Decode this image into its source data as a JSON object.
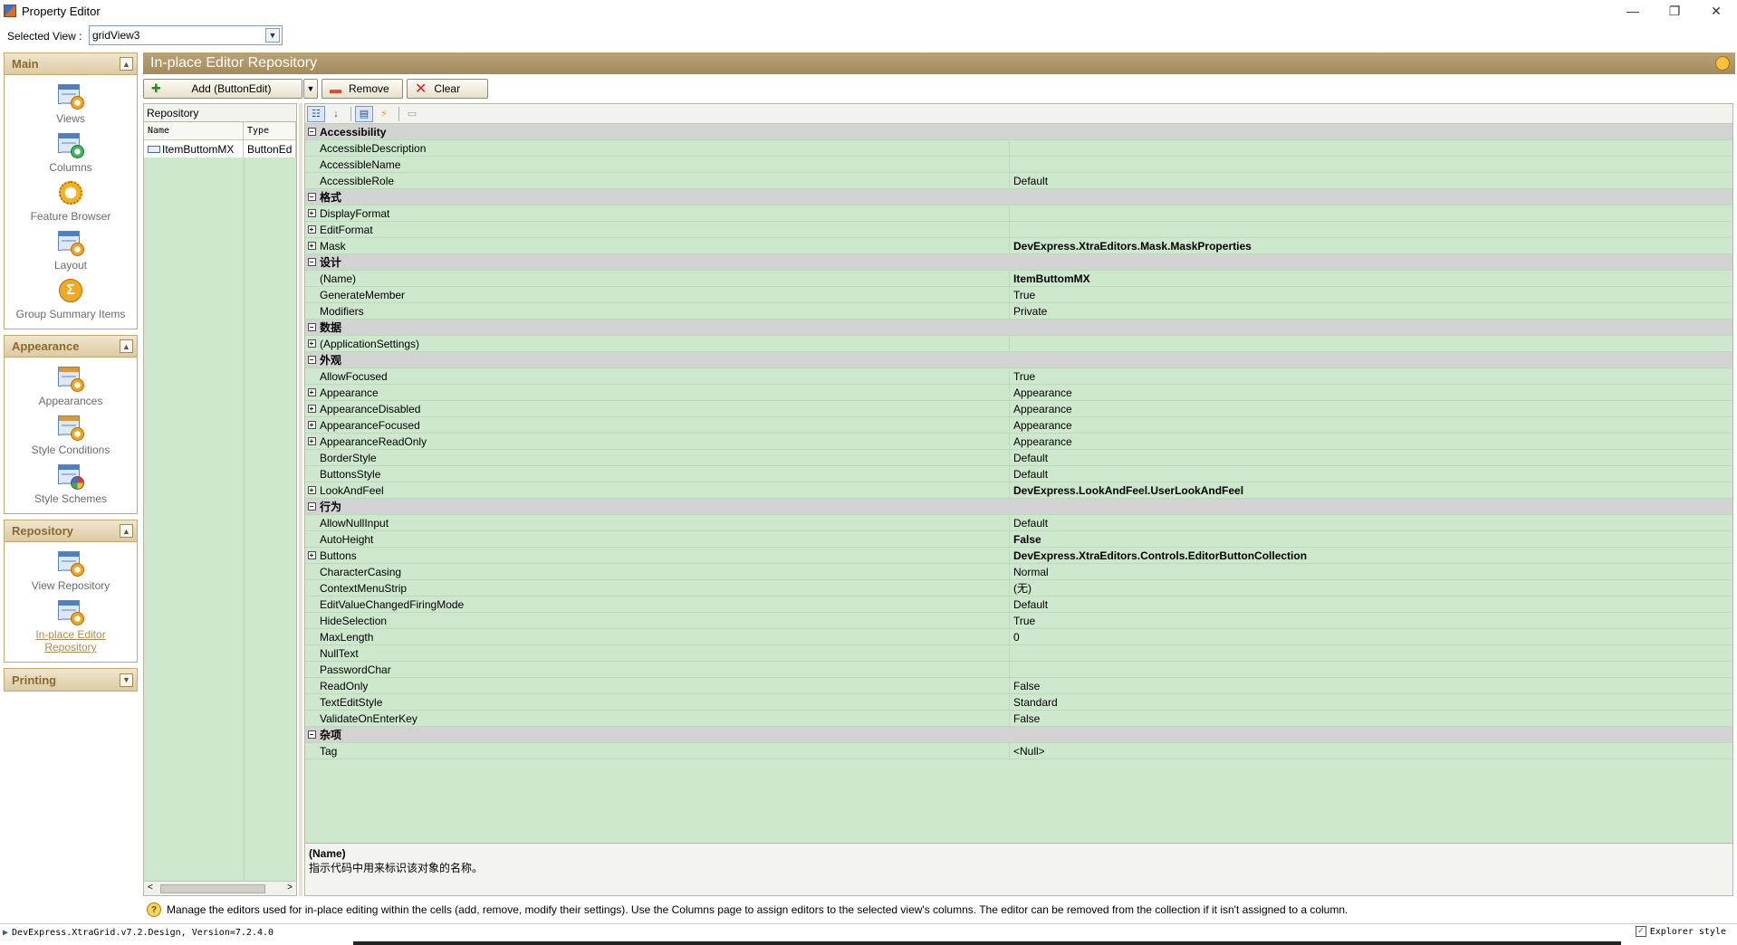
{
  "window": {
    "title": "Property Editor",
    "minimize": "—",
    "restore": "❐",
    "close": "✕"
  },
  "view_selector": {
    "label": "Selected View :",
    "value": "gridView3"
  },
  "nav": {
    "groups": [
      {
        "title": "Main",
        "items": [
          {
            "label": "Views"
          },
          {
            "label": "Columns"
          },
          {
            "label": "Feature Browser"
          },
          {
            "label": "Layout"
          },
          {
            "label": "Group Summary Items"
          }
        ]
      },
      {
        "title": "Appearance",
        "items": [
          {
            "label": "Appearances"
          },
          {
            "label": "Style Conditions"
          },
          {
            "label": "Style Schemes"
          }
        ]
      },
      {
        "title": "Repository",
        "items": [
          {
            "label": "View Repository"
          },
          {
            "label": "In-place Editor Repository"
          }
        ]
      },
      {
        "title": "Printing",
        "items": []
      }
    ]
  },
  "panel": {
    "title": "In-place Editor Repository",
    "buttons": {
      "add": "Add (ButtonEdit)",
      "remove": "Remove",
      "clear": "Clear"
    }
  },
  "repository": {
    "title": "Repository",
    "columns": [
      "Name",
      "Type"
    ],
    "rows": [
      {
        "name": "ItemButtomMX",
        "type": "ButtonEd"
      }
    ]
  },
  "properties": [
    {
      "cat": true,
      "name": "Accessibility"
    },
    {
      "name": "AccessibleDescription",
      "value": ""
    },
    {
      "name": "AccessibleName",
      "value": ""
    },
    {
      "name": "AccessibleRole",
      "value": "Default"
    },
    {
      "cat": true,
      "name": "格式"
    },
    {
      "name": "DisplayFormat",
      "value": "",
      "expand": true
    },
    {
      "name": "EditFormat",
      "value": "",
      "expand": true
    },
    {
      "name": "Mask",
      "value": "DevExpress.XtraEditors.Mask.MaskProperties",
      "expand": true,
      "bold": true
    },
    {
      "cat": true,
      "name": "设计"
    },
    {
      "name": "(Name)",
      "value": "ItemButtomMX",
      "bold": true
    },
    {
      "name": "GenerateMember",
      "value": "True"
    },
    {
      "name": "Modifiers",
      "value": "Private"
    },
    {
      "cat": true,
      "name": "数据"
    },
    {
      "name": "(ApplicationSettings)",
      "value": "",
      "expand": true
    },
    {
      "cat": true,
      "name": "外观"
    },
    {
      "name": "AllowFocused",
      "value": "True"
    },
    {
      "name": "Appearance",
      "value": "Appearance",
      "expand": true
    },
    {
      "name": "AppearanceDisabled",
      "value": "Appearance",
      "expand": true
    },
    {
      "name": "AppearanceFocused",
      "value": "Appearance",
      "expand": true
    },
    {
      "name": "AppearanceReadOnly",
      "value": "Appearance",
      "expand": true
    },
    {
      "name": "BorderStyle",
      "value": "Default"
    },
    {
      "name": "ButtonsStyle",
      "value": "Default"
    },
    {
      "name": "LookAndFeel",
      "value": "DevExpress.LookAndFeel.UserLookAndFeel",
      "expand": true,
      "bold": true
    },
    {
      "cat": true,
      "name": "行为"
    },
    {
      "name": "AllowNullInput",
      "value": "Default"
    },
    {
      "name": "AutoHeight",
      "value": "False",
      "bold": true
    },
    {
      "name": "Buttons",
      "value": "DevExpress.XtraEditors.Controls.EditorButtonCollection",
      "expand": true,
      "bold": true
    },
    {
      "name": "CharacterCasing",
      "value": "Normal"
    },
    {
      "name": "ContextMenuStrip",
      "value": "(无)"
    },
    {
      "name": "EditValueChangedFiringMode",
      "value": "Default"
    },
    {
      "name": "HideSelection",
      "value": "True"
    },
    {
      "name": "MaxLength",
      "value": "0"
    },
    {
      "name": "NullText",
      "value": ""
    },
    {
      "name": "PasswordChar",
      "value": ""
    },
    {
      "name": "ReadOnly",
      "value": "False"
    },
    {
      "name": "TextEditStyle",
      "value": "Standard"
    },
    {
      "name": "ValidateOnEnterKey",
      "value": "False"
    },
    {
      "cat": true,
      "name": "杂项"
    },
    {
      "name": "Tag",
      "value": "<Null>"
    }
  ],
  "description": {
    "title": "(Name)",
    "text": "指示代码中用来标识该对象的名称。"
  },
  "hint": "Manage the editors used for in-place editing within the cells (add, remove, modify their settings). Use the Columns page to assign editors to the selected view's columns. The editor can be removed from the collection if it isn't assigned to a column.",
  "status": {
    "version": "DevExpress.XtraGrid.v7.2.Design, Version=7.2.4.0",
    "explorer_style": "Explorer style",
    "explorer_checked": true
  }
}
